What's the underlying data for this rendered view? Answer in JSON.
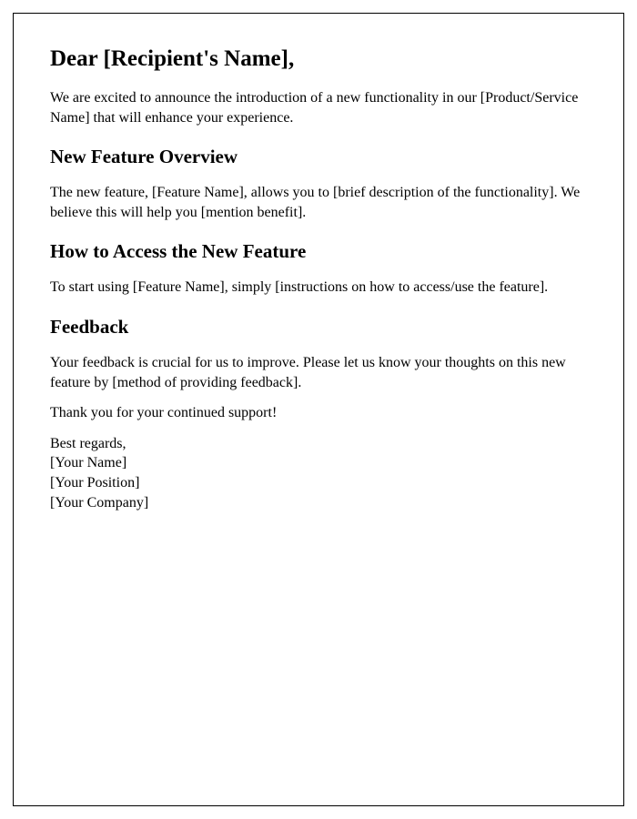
{
  "greeting": "Dear [Recipient's Name],",
  "intro": "We are excited to announce the introduction of a new functionality in our [Product/Service Name] that will enhance your experience.",
  "sections": {
    "overview": {
      "heading": "New Feature Overview",
      "body": "The new feature, [Feature Name], allows you to [brief description of the functionality]. We believe this will help you [mention benefit]."
    },
    "access": {
      "heading": "How to Access the New Feature",
      "body": "To start using [Feature Name], simply [instructions on how to access/use the feature]."
    },
    "feedback": {
      "heading": "Feedback",
      "body": "Your feedback is crucial for us to improve. Please let us know your thoughts on this new feature by [method of providing feedback]."
    }
  },
  "thanks": "Thank you for your continued support!",
  "closing": "Best regards,",
  "signature": {
    "name": "[Your Name]",
    "position": "[Your Position]",
    "company": "[Your Company]"
  }
}
